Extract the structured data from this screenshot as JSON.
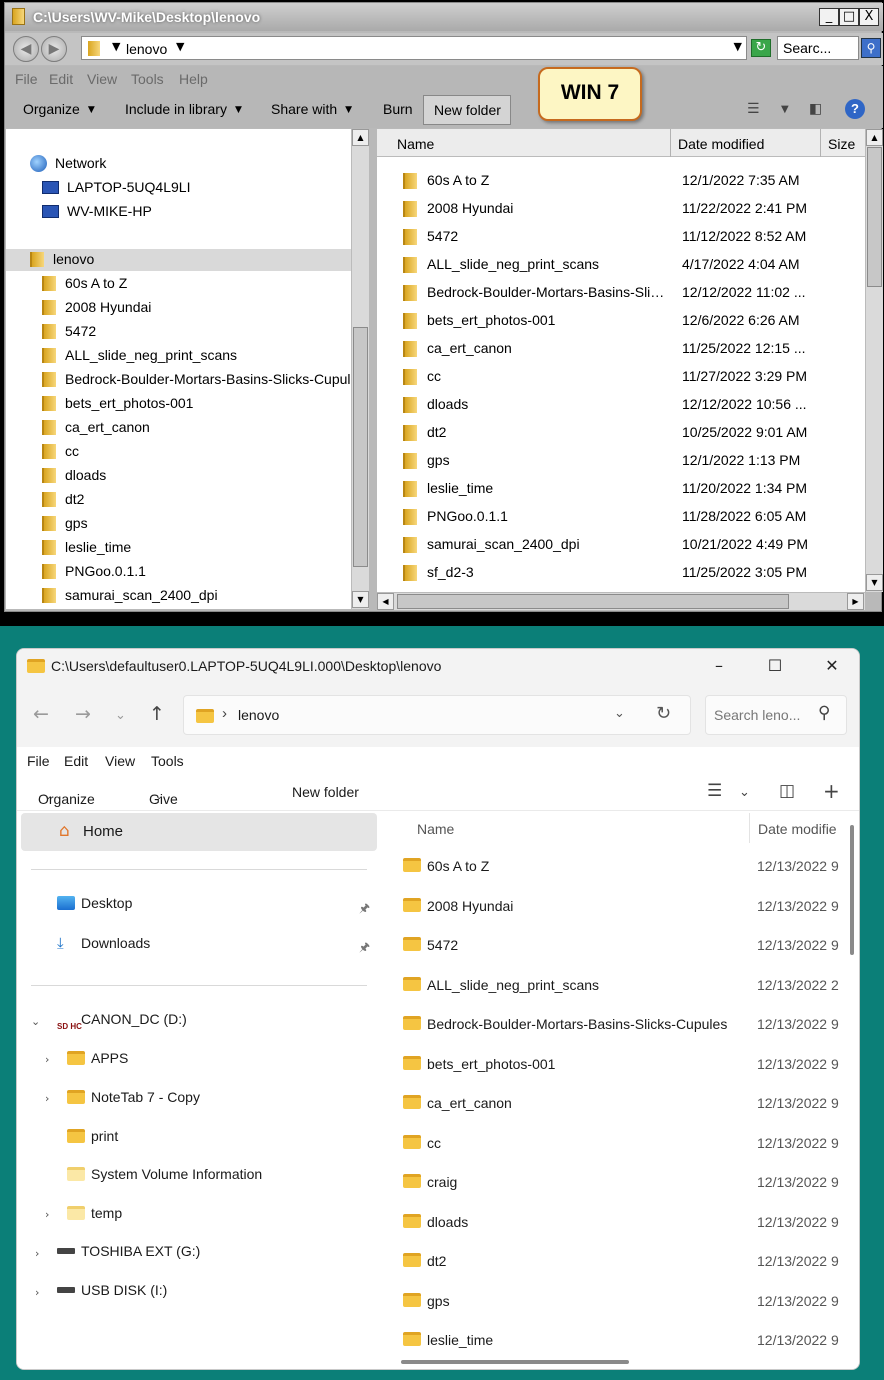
{
  "win7": {
    "title": "C:\\Users\\WV-Mike\\Desktop\\lenovo",
    "caption_buttons": [
      "_",
      "□",
      "X"
    ],
    "address_crumb": "lenovo",
    "search_placeholder": "Searc...",
    "menu": [
      "File",
      "Edit",
      "View",
      "Tools",
      "Help"
    ],
    "commands": {
      "organize": "Organize",
      "include_in_library": "Include in library",
      "share_with": "Share with",
      "burn": "Burn",
      "new_folder": "New folder"
    },
    "badge": "WIN 7",
    "nav": {
      "network": "Network",
      "computers": [
        "LAPTOP-5UQ4L9LI",
        "WV-MIKE-HP"
      ],
      "selected": "lenovo",
      "folders": [
        "60s A to Z",
        "2008 Hyundai",
        "5472",
        "ALL_slide_neg_print_scans",
        "Bedrock-Boulder-Mortars-Basins-Slicks-Cupules",
        "bets_ert_photos-001",
        "ca_ert_canon",
        "cc",
        "dloads",
        "dt2",
        "gps",
        "leslie_time",
        "PNGoo.0.1.1",
        "samurai_scan_2400_dpi"
      ]
    },
    "columns": {
      "name": "Name",
      "date": "Date modified",
      "size": "Size"
    },
    "files": [
      {
        "name": "60s A to Z",
        "date": "12/1/2022 7:35 AM"
      },
      {
        "name": "2008 Hyundai",
        "date": "11/22/2022 2:41 PM"
      },
      {
        "name": "5472",
        "date": "11/12/2022 8:52 AM"
      },
      {
        "name": "ALL_slide_neg_print_scans",
        "date": "4/17/2022 4:04 AM"
      },
      {
        "name": "Bedrock-Boulder-Mortars-Basins-Slick...",
        "date": "12/12/2022 11:02 ..."
      },
      {
        "name": "bets_ert_photos-001",
        "date": "12/6/2022 6:26 AM"
      },
      {
        "name": "ca_ert_canon",
        "date": "11/25/2022 12:15 ..."
      },
      {
        "name": "cc",
        "date": "11/27/2022 3:29 PM"
      },
      {
        "name": "dloads",
        "date": "12/12/2022 10:56 ..."
      },
      {
        "name": "dt2",
        "date": "10/25/2022 9:01 AM"
      },
      {
        "name": "gps",
        "date": "12/1/2022 1:13 PM"
      },
      {
        "name": "leslie_time",
        "date": "11/20/2022 1:34 PM"
      },
      {
        "name": "PNGoo.0.1.1",
        "date": "11/28/2022 6:05 AM"
      },
      {
        "name": "samurai_scan_2400_dpi",
        "date": "10/21/2022 4:49 PM"
      },
      {
        "name": "sf_d2-3",
        "date": "11/25/2022 3:05 PM"
      }
    ]
  },
  "win11": {
    "title": "C:\\Users\\defaultuser0.LAPTOP-5UQ4L9LI.000\\Desktop\\lenovo",
    "address_crumb": "lenovo",
    "search_placeholder": "Search leno...",
    "menu": [
      "File",
      "Edit",
      "View",
      "Tools"
    ],
    "commands": {
      "organize": "Organize",
      "give_access": "Give access to",
      "new_folder": "New folder"
    },
    "nav": {
      "home": "Home",
      "quick": [
        "Desktop",
        "Downloads"
      ],
      "drive_d": "CANON_DC (D:)",
      "drive_d_icon_text": "SD HC",
      "drive_d_children": [
        "APPS",
        "NoteTab 7 - Copy",
        "print",
        "System Volume Information",
        "temp"
      ],
      "drive_g": "TOSHIBA EXT (G:)",
      "drive_i": "USB DISK (I:)"
    },
    "columns": {
      "name": "Name",
      "date": "Date modifie"
    },
    "files": [
      {
        "name": "60s A to Z",
        "date": "12/13/2022 9"
      },
      {
        "name": "2008 Hyundai",
        "date": "12/13/2022 9"
      },
      {
        "name": "5472",
        "date": "12/13/2022 9"
      },
      {
        "name": "ALL_slide_neg_print_scans",
        "date": "12/13/2022 2"
      },
      {
        "name": "Bedrock-Boulder-Mortars-Basins-Slicks-Cupules",
        "date": "12/13/2022 9"
      },
      {
        "name": "bets_ert_photos-001",
        "date": "12/13/2022 9"
      },
      {
        "name": "ca_ert_canon",
        "date": "12/13/2022 9"
      },
      {
        "name": "cc",
        "date": "12/13/2022 9"
      },
      {
        "name": "craig",
        "date": "12/13/2022 9"
      },
      {
        "name": "dloads",
        "date": "12/13/2022 9"
      },
      {
        "name": "dt2",
        "date": "12/13/2022 9"
      },
      {
        "name": "gps",
        "date": "12/13/2022 9"
      },
      {
        "name": "leslie_time",
        "date": "12/13/2022 9"
      }
    ]
  }
}
